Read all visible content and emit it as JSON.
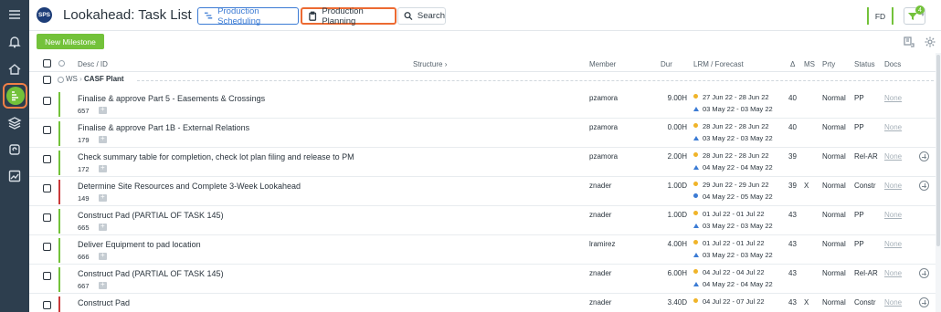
{
  "header": {
    "logo": "SPS",
    "title": "Lookahead: Task List",
    "buttons": {
      "production_scheduling": "Production Scheduling",
      "production_planning": "Production Planning",
      "search": "Search"
    },
    "user_initials": "FD",
    "filter_count": "4"
  },
  "toolbar": {
    "new_milestone": "New Milestone"
  },
  "columns": {
    "desc": "Desc / ID",
    "structure": "Structure",
    "member": "Member",
    "dur": "Dur",
    "lrm": "LRM / Forecast",
    "delta": "Δ",
    "ms": "MS",
    "prty": "Prty",
    "status": "Status",
    "docs": "Docs"
  },
  "group": {
    "prefix": "WS",
    "name": "CASF Plant"
  },
  "colors": {
    "accent_green": "#73c23a",
    "accent_blue": "#3b7bd4",
    "highlight_orange": "#ec6a32",
    "stripe_red": "#c93a3a",
    "rail_bg": "#2d3e4e"
  },
  "rail_icons": [
    "menu-icon",
    "bell-icon",
    "home-icon",
    "task-list-icon",
    "layers-icon",
    "sync-icon",
    "trend-chart-icon"
  ],
  "tasks": [
    {
      "desc": "Finalise & approve Part 5 - Easements & Crossings",
      "id": "657",
      "member": "pzamora",
      "dur": "9.00H",
      "lrm": "27 Jun 22 - 28 Jun 22",
      "forecast": "03 May 22 - 03 May 22",
      "forecast_marker": "triangle",
      "delta": "40",
      "ms": "",
      "prty": "Normal",
      "status": "PP",
      "docs": "None",
      "stripe": "green",
      "add": false
    },
    {
      "desc": "Finalise & approve Part 1B - External Relations",
      "id": "179",
      "member": "pzamora",
      "dur": "0.00H",
      "lrm": "28 Jun 22 - 28 Jun 22",
      "forecast": "03 May 22 - 03 May 22",
      "forecast_marker": "triangle",
      "delta": "40",
      "ms": "",
      "prty": "Normal",
      "status": "PP",
      "docs": "None",
      "stripe": "green",
      "add": false
    },
    {
      "desc": "Check summary table for completion, check lot plan filing and release to PM",
      "id": "172",
      "member": "pzamora",
      "dur": "2.00H",
      "lrm": "28 Jun 22 - 28 Jun 22",
      "forecast": "04 May 22 - 04 May 22",
      "forecast_marker": "triangle",
      "delta": "39",
      "ms": "",
      "prty": "Normal",
      "status": "Rel-AR",
      "docs": "None",
      "stripe": "green",
      "add": true
    },
    {
      "desc": "Determine Site Resources and Complete 3-Week Lookahead",
      "id": "149",
      "member": "znader",
      "dur": "1.00D",
      "lrm": "29 Jun 22 - 29 Jun 22",
      "forecast": "04 May 22 - 05 May 22",
      "forecast_marker": "dot",
      "delta": "39",
      "ms": "X",
      "prty": "Normal",
      "status": "Constr",
      "docs": "None",
      "stripe": "red",
      "add": true
    },
    {
      "desc": "Construct Pad (PARTIAL OF TASK 145)",
      "id": "665",
      "member": "znader",
      "dur": "1.00D",
      "lrm": "01 Jul 22 - 01 Jul 22",
      "forecast": "03 May 22 - 03 May 22",
      "forecast_marker": "triangle",
      "delta": "43",
      "ms": "",
      "prty": "Normal",
      "status": "PP",
      "docs": "None",
      "stripe": "green",
      "add": false
    },
    {
      "desc": "Deliver Equipment to pad location",
      "id": "666",
      "member": "lramirez",
      "dur": "4.00H",
      "lrm": "01 Jul 22 - 01 Jul 22",
      "forecast": "03 May 22 - 03 May 22",
      "forecast_marker": "triangle",
      "delta": "43",
      "ms": "",
      "prty": "Normal",
      "status": "PP",
      "docs": "None",
      "stripe": "green",
      "add": false
    },
    {
      "desc": "Construct Pad (PARTIAL OF TASK 145)",
      "id": "667",
      "member": "znader",
      "dur": "6.00H",
      "lrm": "04 Jul 22 - 04 Jul 22",
      "forecast": "04 May 22 - 04 May 22",
      "forecast_marker": "triangle",
      "delta": "43",
      "ms": "",
      "prty": "Normal",
      "status": "Rel-AR",
      "docs": "None",
      "stripe": "green",
      "add": true
    },
    {
      "desc": "Construct Pad",
      "id": "",
      "member": "znader",
      "dur": "3.40D",
      "lrm": "04 Jul 22 - 07 Jul 22",
      "forecast": "",
      "forecast_marker": "",
      "delta": "43",
      "ms": "X",
      "prty": "Normal",
      "status": "Constr",
      "docs": "None",
      "stripe": "red",
      "add": true
    }
  ]
}
